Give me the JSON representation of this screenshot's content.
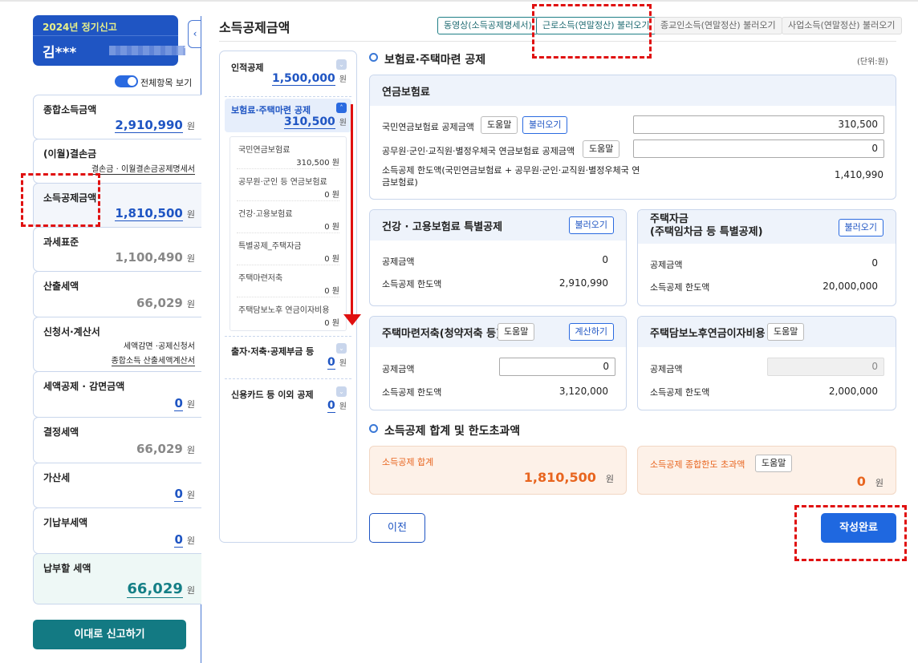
{
  "sidebar": {
    "filing_type": "2024년 정기신고",
    "user_name": "김***",
    "user_name_suffix": "**",
    "toggle_label": "전체항목 보기",
    "items": [
      {
        "label": "종합소득금액",
        "value": "2,910,990",
        "unit": "원"
      },
      {
        "label": "(이월)결손금",
        "link": "결손금 · 이월결손금공제명세서"
      },
      {
        "label": "소득공제금액",
        "value": "1,810,500",
        "unit": "원"
      },
      {
        "label": "과세표준",
        "value": "1,100,490",
        "unit": "원"
      },
      {
        "label": "산출세액",
        "value": "66,029",
        "unit": "원"
      },
      {
        "label": "신청서·계산서",
        "link1": "세액감면 ·공제신청서",
        "link2": "종합소득 산출세액계산서"
      },
      {
        "label": "세액공제 · 감면금액",
        "value": "0",
        "unit": "원"
      },
      {
        "label": "결정세액",
        "value": "66,029",
        "unit": "원"
      },
      {
        "label": "가산세",
        "value": "0",
        "unit": "원"
      },
      {
        "label": "기납부세액",
        "value": "0",
        "unit": "원"
      },
      {
        "label": "납부할 세액",
        "value": "66,029",
        "unit": "원"
      }
    ],
    "submit_label": "이대로 신고하기"
  },
  "header": {
    "title": "소득공제금액",
    "buttons": [
      "동영상(소득공제명세서)",
      "근로소득(연말정산) 불러오기",
      "종교인소득(연말정산) 불러오기",
      "사업소득(연말정산) 불러오기"
    ]
  },
  "nav": {
    "items": [
      {
        "label": "인적공제",
        "value": "1,500,000",
        "unit": "원"
      },
      {
        "label": "보험료·주택마련 공제",
        "value": "310,500",
        "unit": "원"
      },
      {
        "label": "출자·저축·공제부금 등",
        "value": "0",
        "unit": "원"
      },
      {
        "label": "신용카드 등 이외 공제",
        "value": "0",
        "unit": "원"
      }
    ],
    "sub_items": [
      {
        "label": "국민연금보험료",
        "value": "310,500 원"
      },
      {
        "label": "공무원·군인 등 연금보험료",
        "value": "0 원"
      },
      {
        "label": "건강·고용보험료",
        "value": "0 원"
      },
      {
        "label": "특별공제_주택자금",
        "value": "0 원"
      },
      {
        "label": "주택마련저축",
        "value": "0 원"
      },
      {
        "label": "주택담보노후 연금이자비용",
        "value": "0 원"
      }
    ]
  },
  "main": {
    "section_title": "보험료·주택마련 공제",
    "unit_note": "(단위:원)",
    "pension": {
      "title": "연금보험료",
      "row1_label": "국민연금보험료 공제금액",
      "help": "도움말",
      "load": "불러오기",
      "row1_value": "310,500",
      "row2_label": "공무원·군인·교직원·별정우체국 연금보험료 공제금액",
      "row2_value": "0",
      "row3_label": "소득공제 한도액(국민연금보험료 + 공무원·군인·교직원·별정우체국 연금보험료)",
      "row3_value": "1,410,990"
    },
    "health": {
      "title": "건강 · 고용보험료 특별공제",
      "load": "불러오기",
      "deduct_label": "공제금액",
      "deduct_value": "0",
      "limit_label": "소득공제 한도액",
      "limit_value": "2,910,990"
    },
    "housing": {
      "title_line1": "주택자금",
      "title_line2": "(주택임차금 등 특별공제)",
      "load": "불러오기",
      "deduct_label": "공제금액",
      "deduct_value": "0",
      "limit_label": "소득공제 한도액",
      "limit_value": "20,000,000"
    },
    "savings": {
      "title": "주택마련저축(청약저축 등)",
      "help": "도움말",
      "calc": "계산하기",
      "deduct_label": "공제금액",
      "deduct_value": "0",
      "limit_label": "소득공제 한도액",
      "limit_value": "3,120,000"
    },
    "mortgage": {
      "title": "주택담보노후연금이자비용",
      "help": "도움말",
      "deduct_label": "공제금액",
      "deduct_value": "0",
      "limit_label": "소득공제 한도액",
      "limit_value": "2,000,000"
    },
    "summary_title": "소득공제 합계 및 한도초과액",
    "total": {
      "label": "소득공제 합계",
      "value": "1,810,500",
      "unit": "원"
    },
    "excess": {
      "label": "소득공제 종합한도 초과액",
      "help": "도움말",
      "value": "0",
      "unit": "원"
    },
    "prev_label": "이전",
    "done_label": "작성완료"
  }
}
